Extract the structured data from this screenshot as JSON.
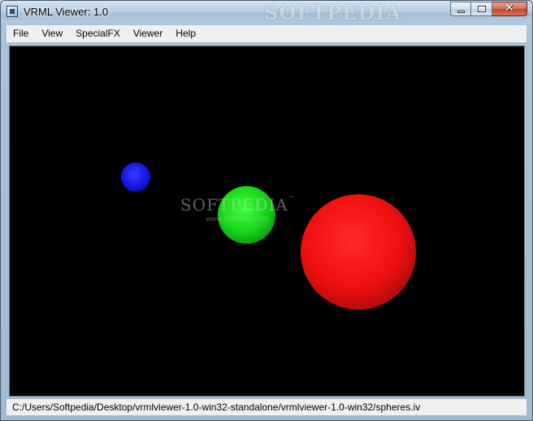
{
  "window": {
    "title": "VRML Viewer: 1.0",
    "watermark": "SOFTPEDIA",
    "caption_buttons": {
      "minimize": "minimize-icon",
      "maximize": "maximize-icon",
      "close": "✕"
    }
  },
  "menubar": {
    "items": [
      {
        "label": "File"
      },
      {
        "label": "View"
      },
      {
        "label": "SpecialFX"
      },
      {
        "label": "Viewer"
      },
      {
        "label": "Help"
      }
    ]
  },
  "scene": {
    "background": "#000000",
    "spheres": [
      {
        "name": "blue-sphere",
        "color": "#1414e0"
      },
      {
        "name": "green-sphere",
        "color": "#18d418"
      },
      {
        "name": "red-sphere",
        "color": "#f01010"
      }
    ],
    "watermark": {
      "brand": "SOFTPEDIA",
      "trademark": "™",
      "url": "www.softpedia.com"
    }
  },
  "statusbar": {
    "path": "C:/Users/Softpedia/Desktop/vrmlviewer-1.0-win32-standalone/vrmlviewer-1.0-win32/spheres.iv"
  }
}
